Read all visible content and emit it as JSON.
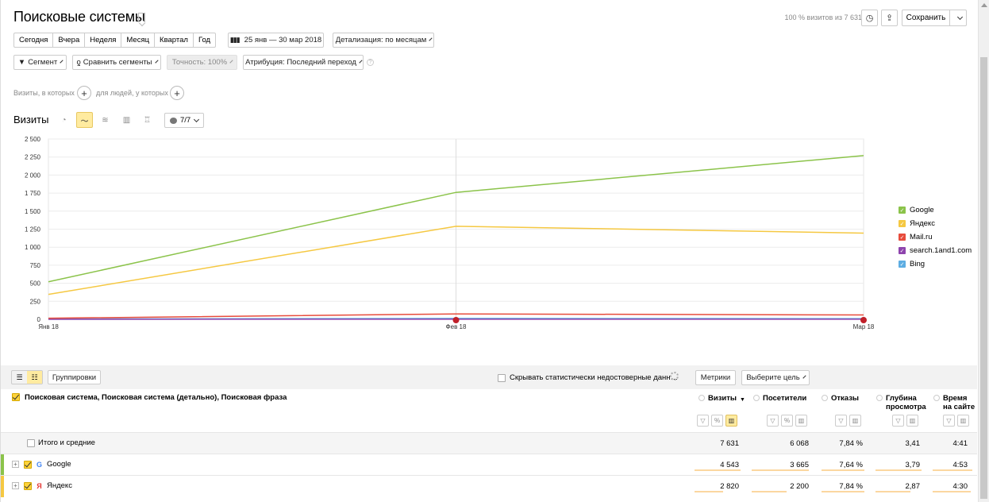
{
  "header": {
    "title": "Поисковые системы",
    "visits_share": "100 % визитов из 7 631",
    "save_label": "Сохранить"
  },
  "toolbar": {
    "periods": [
      "Сегодня",
      "Вчера",
      "Неделя",
      "Месяц",
      "Квартал",
      "Год"
    ],
    "date_range": "25 янв — 30 мар 2018",
    "detail": "Детализация: по месяцам",
    "segment": "Сегмент",
    "compare": "Сравнить сегменты",
    "accuracy": "Точность: 100%",
    "attribution": "Атрибуция: Последний переход"
  },
  "conditions": {
    "visits_where": "Визиты, в которых",
    "people_where": "для людей, у которых"
  },
  "chart": {
    "label": "Визиты",
    "series_count": "7/7"
  },
  "chart_data": {
    "type": "line",
    "x": [
      "Янв 18",
      "Фев 18",
      "Мар 18"
    ],
    "y_ticks": [
      "0",
      "250",
      "500",
      "750",
      "1 000",
      "1 250",
      "1 500",
      "1 750",
      "2 000",
      "2 250",
      "2 500"
    ],
    "ylim": [
      0,
      2500
    ],
    "grid": true,
    "legend_position": "right",
    "series": [
      {
        "name": "Google",
        "color": "#8bc34a",
        "values": [
          520,
          1760,
          2270
        ]
      },
      {
        "name": "Яндекс",
        "color": "#f5c842",
        "values": [
          345,
          1290,
          1195
        ]
      },
      {
        "name": "Mail.ru",
        "color": "#e74c3c",
        "values": [
          15,
          75,
          60
        ]
      },
      {
        "name": "search.1and1.com",
        "color": "#8e44ad",
        "values": [
          0,
          2,
          1
        ]
      },
      {
        "name": "Bing",
        "color": "#5dade2",
        "values": [
          4,
          12,
          10
        ]
      }
    ]
  },
  "table": {
    "groupings": "Группировки",
    "hide_stats": "Скрывать статистически недостоверные данн…",
    "metrics_btn": "Метрики",
    "goal_btn": "Выберите цель",
    "dimensions": "Поисковая система, Поисковая система (детально), Поисковая фраза",
    "columns": [
      {
        "line1": "Визиты",
        "line2": ""
      },
      {
        "line1": "Посетители",
        "line2": ""
      },
      {
        "line1": "Отказы",
        "line2": ""
      },
      {
        "line1": "Глубина",
        "line2": "просмотра"
      },
      {
        "line1": "Время",
        "line2": "на сайте"
      }
    ],
    "totals": {
      "label": "Итого и средние",
      "values": [
        "7 631",
        "6 068",
        "7,84 %",
        "3,41",
        "4:41"
      ]
    },
    "rows": [
      {
        "label": "Google",
        "icon": "G",
        "stripe": "#8bc34a",
        "values": [
          "4 543",
          "3 665",
          "7,64 %",
          "3,79",
          "4:53"
        ]
      },
      {
        "label": "Яндекс",
        "icon": "Я",
        "stripe": "#f5c842",
        "values": [
          "2 820",
          "2 200",
          "7,84 %",
          "2,87",
          "4:30"
        ]
      }
    ]
  }
}
